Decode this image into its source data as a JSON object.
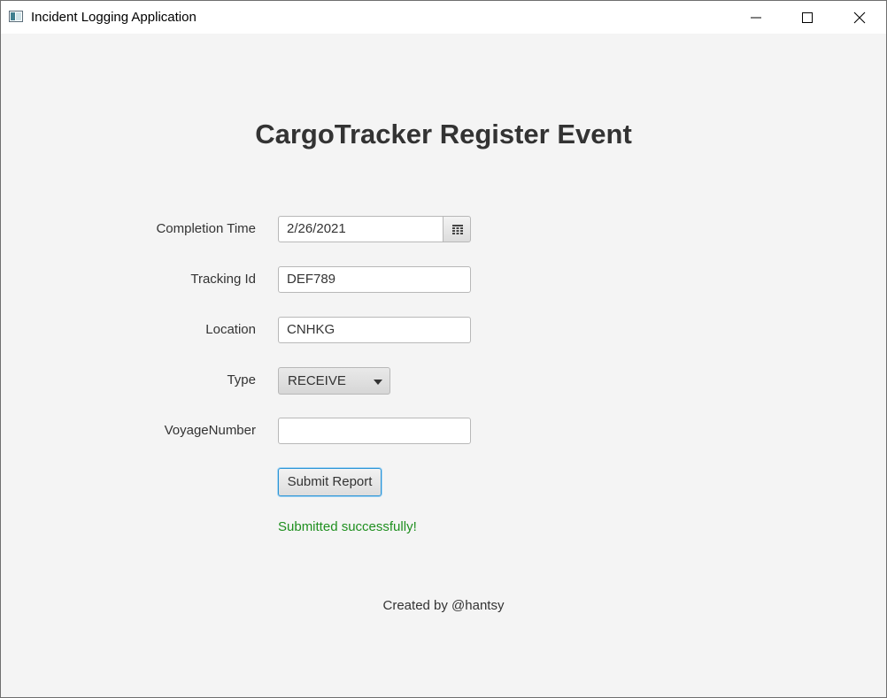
{
  "window": {
    "title": "Incident Logging Application",
    "app_icon": "java-window-icon",
    "controls": [
      "minimize-icon",
      "maximize-icon",
      "close-icon"
    ]
  },
  "form": {
    "heading": "CargoTracker Register Event",
    "completion_time": {
      "label": "Completion Time",
      "value": "2/26/2021",
      "picker_icon": "calendar-icon"
    },
    "tracking_id": {
      "label": "Tracking Id",
      "value": "DEF789"
    },
    "location": {
      "label": "Location",
      "value": "CNHKG"
    },
    "type": {
      "label": "Type",
      "selected": "RECEIVE",
      "arrow_icon": "caret-down-icon"
    },
    "voyage_number": {
      "label": "VoyageNumber",
      "value": ""
    },
    "submit_label": "Submit Report",
    "status_message": "Submitted successfully!"
  },
  "footer": {
    "text": "Created by @hantsy"
  },
  "colors": {
    "background": "#f4f4f4",
    "success": "#1f8f1f",
    "focus_border": "#2a94d6"
  }
}
